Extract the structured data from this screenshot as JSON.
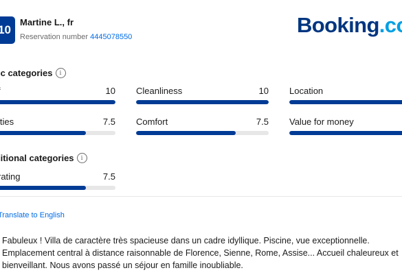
{
  "review": {
    "score": "10",
    "reviewer": "Martine L., fr",
    "reservation_label": "Reservation number",
    "reservation_number": "4445078550"
  },
  "logo": {
    "part1": "Booking",
    "part2": ".co"
  },
  "basic": {
    "title": "ic categories",
    "categories": [
      {
        "label": "f",
        "value": "10",
        "fraction": 1.0
      },
      {
        "label": "Cleanliness",
        "value": "10",
        "fraction": 1.0
      },
      {
        "label": "Location",
        "value": "",
        "fraction": 1.0
      },
      {
        "label": "ities",
        "value": "7.5",
        "fraction": 0.75
      },
      {
        "label": "Comfort",
        "value": "7.5",
        "fraction": 0.75
      },
      {
        "label": "Value for money",
        "value": "",
        "fraction": 1.0
      }
    ]
  },
  "additional": {
    "title": "litional categories",
    "categories": [
      {
        "label": "rating",
        "value": "7.5",
        "fraction": 0.75
      }
    ]
  },
  "translate_label": "Translate to English",
  "review_text": {
    "line1": "Fabuleux ! Villa de caractère très spacieuse dans un cadre idyllique. Piscine, vue exceptionnelle.",
    "line2": "Emplacement central à distance raisonnable de Florence, Sienne, Rome, Assise... Accueil chaleureux et",
    "line3": "bienveillant. Nous avons passé un séjour en famille inoubliable."
  },
  "colors": {
    "brand_blue": "#003b95",
    "link_blue": "#006ce4",
    "track": "#e7e7e7"
  }
}
